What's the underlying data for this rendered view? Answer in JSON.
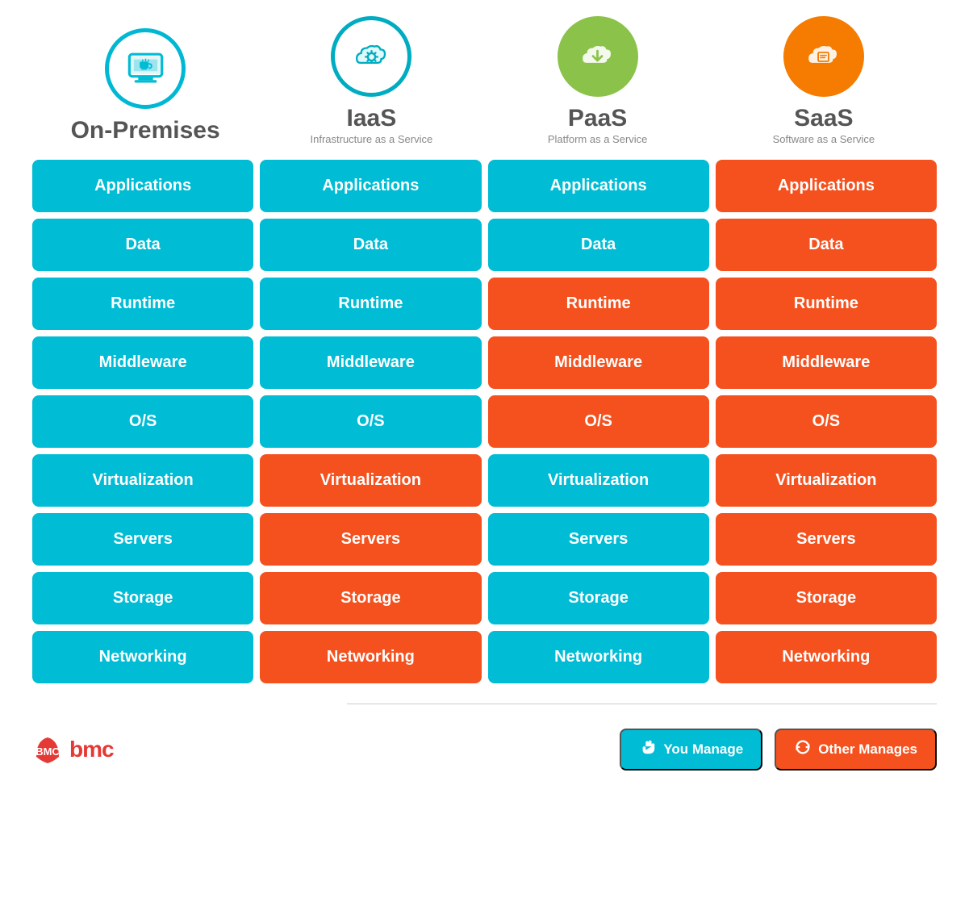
{
  "columns": [
    {
      "id": "on-premises",
      "title": "On-Premises",
      "subtitle": "",
      "icon": "monitor",
      "icon_style": "blue"
    },
    {
      "id": "iaas",
      "title": "IaaS",
      "subtitle": "Infrastructure as a Service",
      "icon": "gear-cloud",
      "icon_style": "teal"
    },
    {
      "id": "paas",
      "title": "PaaS",
      "subtitle": "Platform as a Service",
      "icon": "download-cloud",
      "icon_style": "green"
    },
    {
      "id": "saas",
      "title": "SaaS",
      "subtitle": "Software as a Service",
      "icon": "doc-cloud",
      "icon_style": "orange"
    }
  ],
  "rows": [
    {
      "label": "Applications",
      "cells": [
        "cyan",
        "cyan",
        "cyan",
        "orange"
      ]
    },
    {
      "label": "Data",
      "cells": [
        "cyan",
        "cyan",
        "cyan",
        "orange"
      ]
    },
    {
      "label": "Runtime",
      "cells": [
        "cyan",
        "cyan",
        "orange",
        "orange"
      ]
    },
    {
      "label": "Middleware",
      "cells": [
        "cyan",
        "cyan",
        "orange",
        "orange"
      ]
    },
    {
      "label": "O/S",
      "cells": [
        "cyan",
        "cyan",
        "orange",
        "orange"
      ]
    },
    {
      "label": "Virtualization",
      "cells": [
        "cyan",
        "orange",
        "cyan",
        "orange"
      ]
    },
    {
      "label": "Servers",
      "cells": [
        "cyan",
        "orange",
        "cyan",
        "orange"
      ]
    },
    {
      "label": "Storage",
      "cells": [
        "cyan",
        "orange",
        "cyan",
        "orange"
      ]
    },
    {
      "label": "Networking",
      "cells": [
        "cyan",
        "orange",
        "cyan",
        "orange"
      ]
    }
  ],
  "legend": {
    "you_manage_label": "You Manage",
    "other_manages_label": "Other Manages"
  },
  "bmc": {
    "logo_text": "bmc"
  }
}
